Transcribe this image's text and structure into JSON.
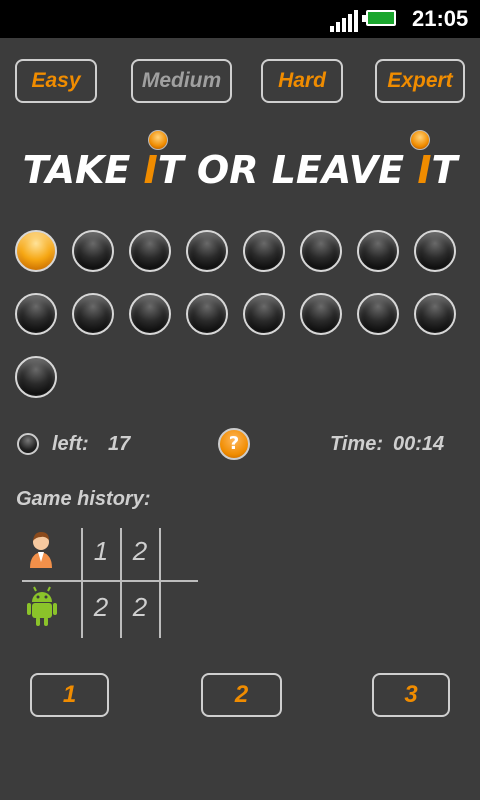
{
  "status_bar": {
    "time": "21:05"
  },
  "difficulty": [
    {
      "label": "Easy",
      "color": "#f08c00"
    },
    {
      "label": "Medium",
      "color": "#a0a0a0"
    },
    {
      "label": "Hard",
      "color": "#f08c00"
    },
    {
      "label": "Expert",
      "color": "#f08c00"
    }
  ],
  "title": {
    "part1": "TAKE ",
    "hl1": "I",
    "part2": "T OR LEAVE ",
    "hl2": "I",
    "part3": "T"
  },
  "balls": {
    "total": 17,
    "active_index": 0
  },
  "info": {
    "left_label": "left:",
    "left_value": "17",
    "help_label": "?",
    "time_label": "Time:",
    "time_value": "00:14"
  },
  "history": {
    "title": "Game history:",
    "rows": [
      {
        "player": "person-icon",
        "scores": [
          "1",
          "2"
        ]
      },
      {
        "player": "android-icon",
        "scores": [
          "2",
          "2"
        ]
      }
    ]
  },
  "buttons": [
    "1",
    "2",
    "3"
  ]
}
